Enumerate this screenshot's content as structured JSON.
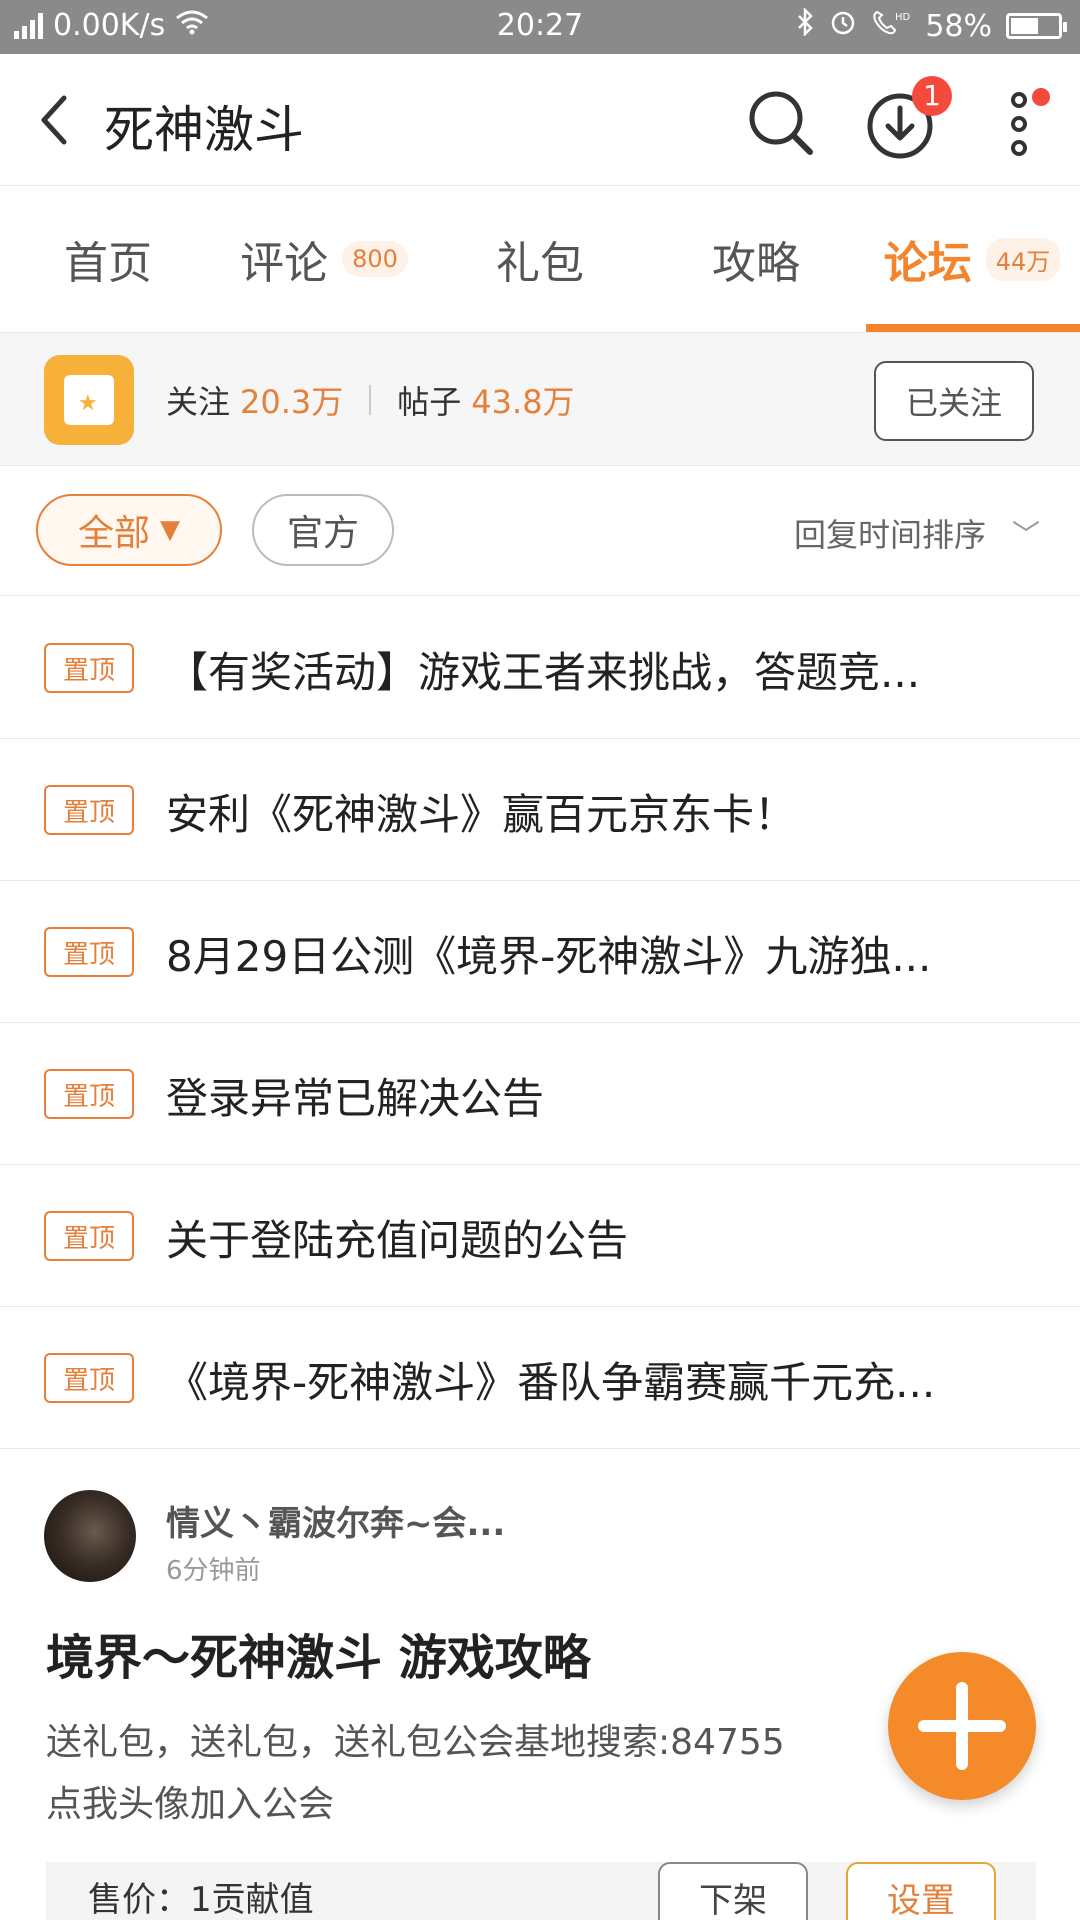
{
  "status_bar": {
    "network": "4G",
    "speed": "0.00K/s",
    "time": "20:27",
    "battery": "58%",
    "battery_level": 0.58
  },
  "header": {
    "title": "死神激斗",
    "download_badge": "1"
  },
  "tabs": [
    {
      "label": "首页",
      "count": ""
    },
    {
      "label": "评论",
      "count": "800"
    },
    {
      "label": "礼包",
      "count": ""
    },
    {
      "label": "攻略",
      "count": ""
    },
    {
      "label": "论坛",
      "count": "44万",
      "active": true
    }
  ],
  "forum": {
    "follow_label": "关注",
    "follow_count": "20.3万",
    "posts_label": "帖子",
    "posts_count": "43.8万",
    "followed_button": "已关注"
  },
  "filters": {
    "all": "全部",
    "official": "官方",
    "sort": "回复时间排序"
  },
  "pinned": {
    "tag": "置顶",
    "items": [
      "【有奖活动】游戏王者来挑战，答题竞...",
      "安利《死神激斗》赢百元京东卡！",
      "8月29日公测《境界-死神激斗》九游独...",
      "登录异常已解决公告",
      "关于登陆充值问题的公告",
      "《境界-死神激斗》番队争霸赛赢千元充..."
    ]
  },
  "post": {
    "author": "情义丶霸波尔奔~会...",
    "time": "6分钟前",
    "title": "境界～死神激斗 游戏攻略",
    "body_line1": "送礼包，送礼包，送礼包公会基地搜索:84755",
    "body_line2": "点我头像加入公会",
    "price": "售价：1贡献值",
    "btn_off": "下架",
    "btn_set": "设置"
  },
  "colors": {
    "accent": "#f2852e",
    "badge": "#f44a3c",
    "forum_icon": "#f7b03a"
  }
}
